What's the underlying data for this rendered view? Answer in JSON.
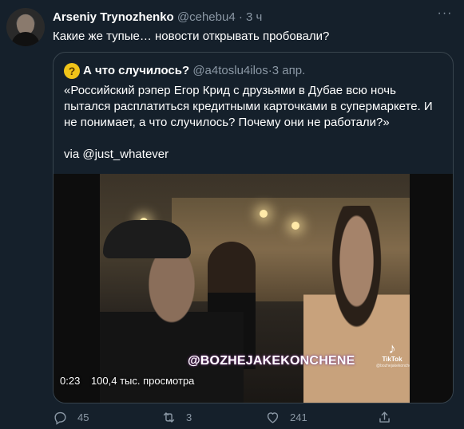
{
  "tweet": {
    "author_name": "Arseniy Trynozhenko",
    "author_handle": "@cehebu4",
    "separator": " · ",
    "time": "3 ч",
    "text": "Какие же тупые… новости открывать пробовали?"
  },
  "quote": {
    "avatar_emoji": "?",
    "author_name": "А что случилось?",
    "author_handle": "@a4toslu4ilos",
    "separator": " · ",
    "time": "3 апр.",
    "text_main": "«Российский рэпер Егор Крид с друзьями в Дубае всю ночь пытался расплатиться кредитными карточками в супермаркете. И не понимает, а что случилось? Почему они не работали?»",
    "text_via": "via @just_whatever",
    "video": {
      "watermark": "@BOZHEJAKEKONCHENE",
      "tiktok_label": "TikTok",
      "tiktok_user": "@bozhejakekonchene",
      "duration": "0:23",
      "views": "100,4 тыс. просмотра"
    }
  },
  "actions": {
    "reply_count": "45",
    "retweet_count": "3",
    "like_count": "241"
  },
  "colors": {
    "background": "#15202b",
    "secondary_text": "#8b98a5",
    "border": "#38444d"
  }
}
